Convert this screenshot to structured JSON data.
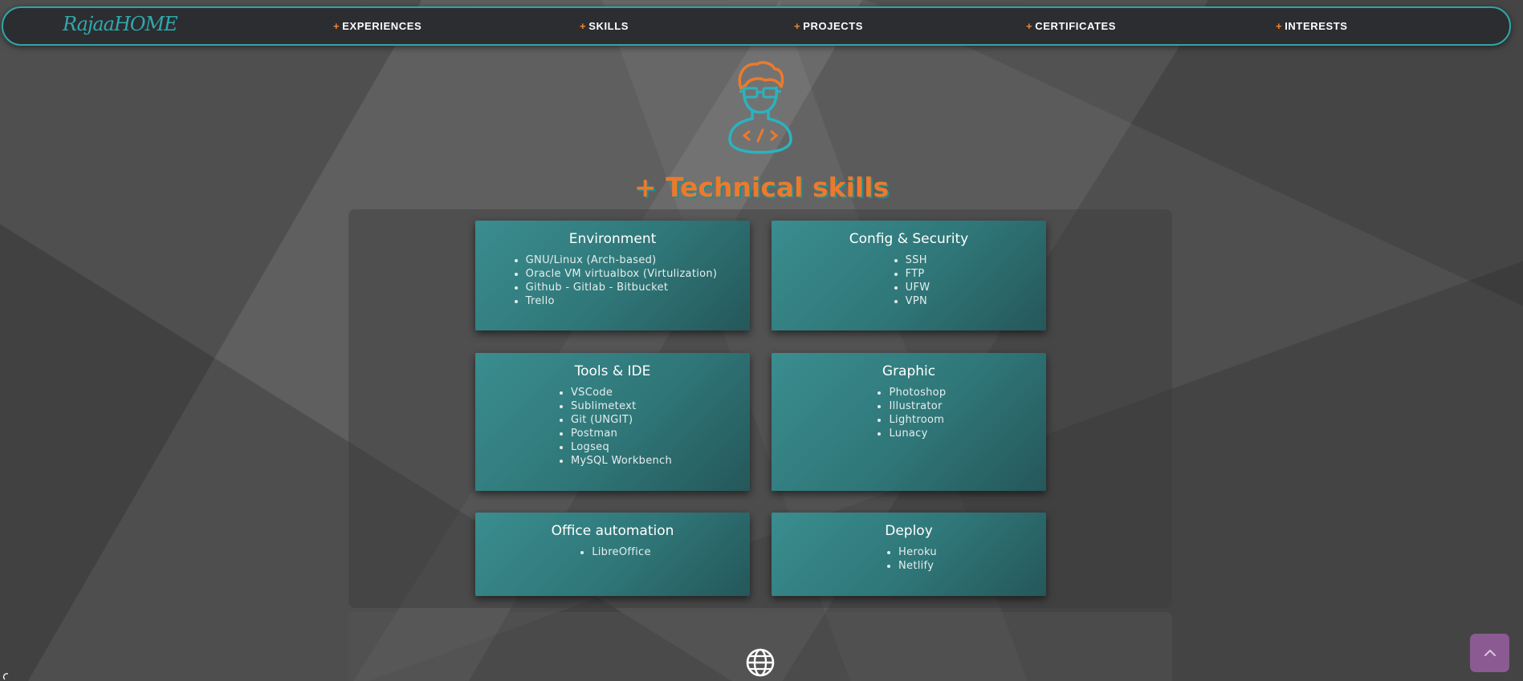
{
  "navbar": {
    "brand": "RajaaHOME",
    "plus_symbol": "+",
    "items": [
      {
        "label": "EXPERIENCES"
      },
      {
        "label": "SKILLS"
      },
      {
        "label": "PROJECTS"
      },
      {
        "label": "CERTIFICATES"
      },
      {
        "label": "INTERESTS"
      }
    ]
  },
  "section": {
    "title": "+ Technical skills"
  },
  "cards": [
    {
      "title": "Environment",
      "items": [
        "GNU/Linux (Arch-based)",
        "Oracle VM virtualbox (Virtulization)",
        "Github - Gitlab - Bitbucket",
        "Trello"
      ]
    },
    {
      "title": "Config & Security",
      "items": [
        "SSH",
        "FTP",
        "UFW",
        "VPN"
      ]
    },
    {
      "title": "Tools & IDE",
      "items": [
        "VSCode",
        "Sublimetext",
        "Git (UNGIT)",
        "Postman",
        "Logseq",
        "MySQL Workbench"
      ]
    },
    {
      "title": "Graphic",
      "items": [
        "Photoshop",
        "Illustrator",
        "Lightroom",
        "Lunacy"
      ]
    },
    {
      "title": "Office automation",
      "items": [
        "LibreOffice"
      ]
    },
    {
      "title": "Deploy",
      "items": [
        "Heroku",
        "Netlify"
      ]
    }
  ],
  "icons": {
    "avatar": "developer-avatar-icon",
    "globe": "globe-icon",
    "to_top": "chevron-up-icon"
  },
  "colors": {
    "accent_orange": "#f08630",
    "accent_teal": "#2fa6a8",
    "card_teal": "#33807f",
    "to_top_purple": "#8b5a93",
    "nav_bg": "#2c2d30"
  }
}
